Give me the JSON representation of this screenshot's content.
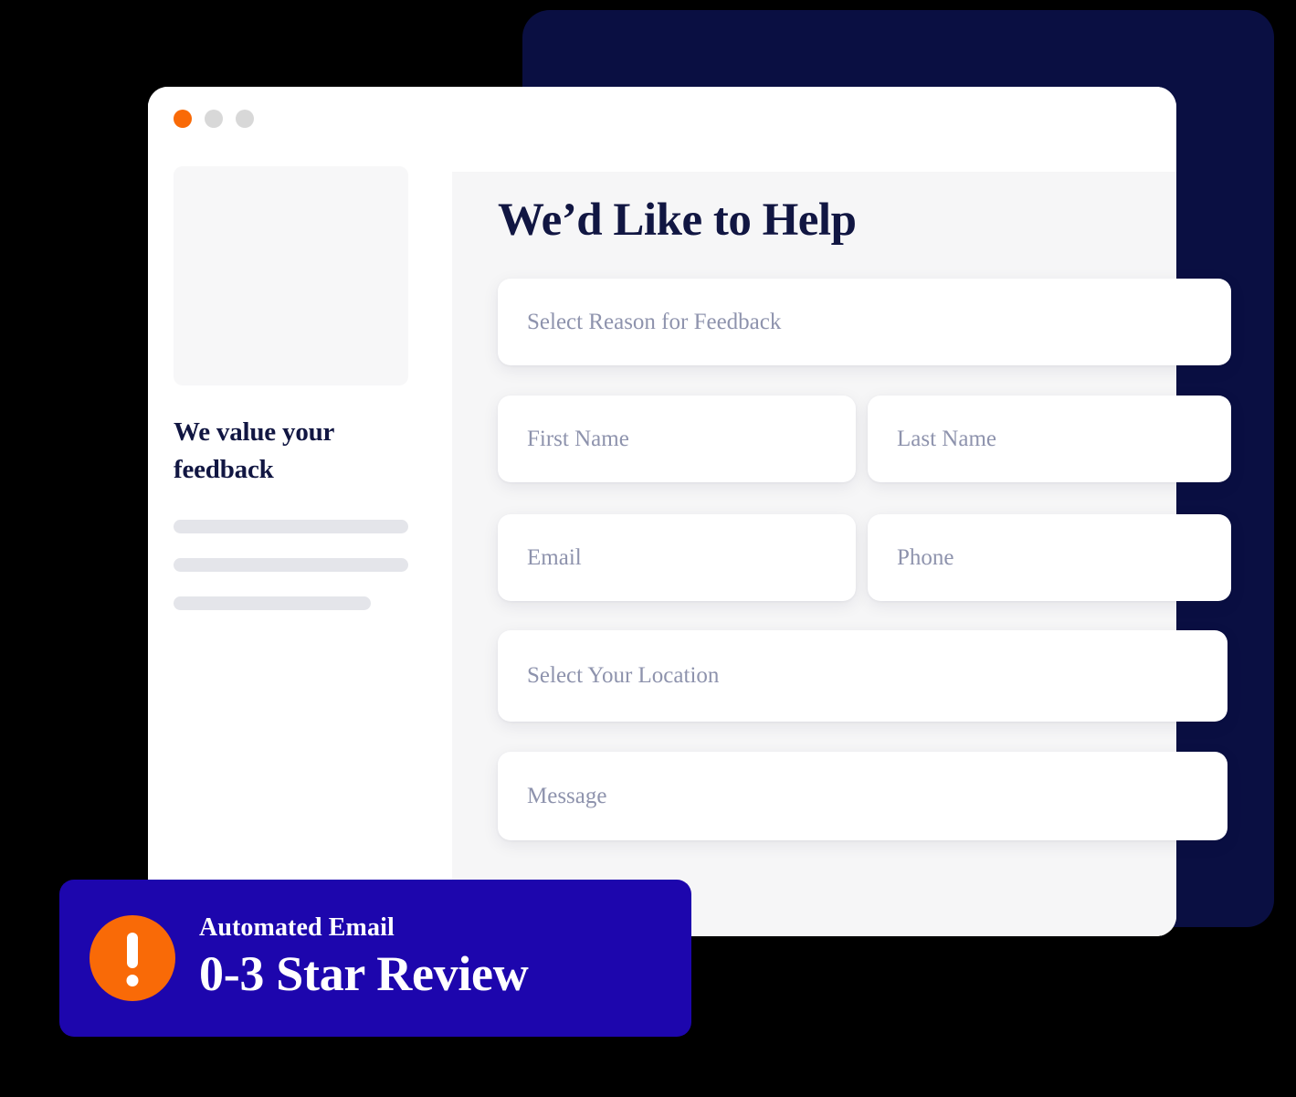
{
  "window": {
    "controls": [
      {
        "name": "close-dot",
        "color": "#f96a07"
      },
      {
        "name": "minimize-dot",
        "color": "#d8d8d8"
      },
      {
        "name": "maximize-dot",
        "color": "#d8d8d8"
      }
    ]
  },
  "sidebar": {
    "heading": "We value your feedback",
    "image_placeholder": "image-placeholder",
    "skeleton_lines": 3
  },
  "form": {
    "heading": "We’d Like to Help",
    "fields": [
      {
        "name": "reason",
        "placeholder": "Select Reason for Feedback",
        "type": "select"
      },
      {
        "name": "first_name",
        "placeholder": "First Name",
        "type": "text"
      },
      {
        "name": "last_name",
        "placeholder": "Last Name",
        "type": "text"
      },
      {
        "name": "email",
        "placeholder": "Email",
        "type": "email"
      },
      {
        "name": "phone",
        "placeholder": "Phone",
        "type": "tel"
      },
      {
        "name": "location",
        "placeholder": "Select Your Location",
        "type": "select"
      },
      {
        "name": "message",
        "placeholder": "Message",
        "type": "textarea"
      }
    ]
  },
  "banner": {
    "eyebrow": "Automated Email",
    "title": "0-3 Star Review",
    "icon": "exclamation-circle-icon",
    "background_color": "#1d06ad",
    "icon_color": "#f96a07"
  },
  "colors": {
    "navy_card": "#0a0f42",
    "accent_orange": "#f96a07",
    "banner_blue": "#1d06ad",
    "heading_navy": "#111642",
    "placeholder_text": "#8e93ad",
    "panel_background": "#f6f6f7",
    "skeleton": "#e4e5ea",
    "page_background": "#000000"
  }
}
